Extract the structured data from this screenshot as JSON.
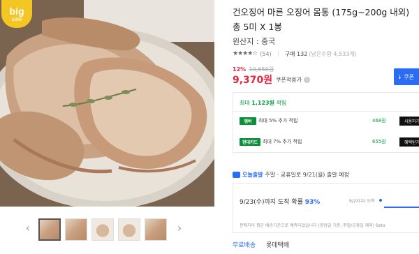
{
  "badge": {
    "line1": "big",
    "line2": "sale"
  },
  "product": {
    "title": "건오징어 마른 오징어 몸통 (175g~200g 내외) 총 5미 X 1봉",
    "origin": "원산지 : 중국",
    "rating": {
      "stars": "★★★★☆",
      "count": "(54)"
    },
    "purchase": {
      "label": "구매 132",
      "stock": "(남은수량 4,533개)"
    }
  },
  "price": {
    "discount_pct": "12%",
    "original": "10,650원",
    "final": "9,370원",
    "coupon_label": "쿠폰적용가",
    "coupon_button": "↓ 쿠폰"
  },
  "points": {
    "header_prefix": "최대 ",
    "header_amount": "1,123원",
    "header_suffix": " 적립",
    "rows": [
      {
        "card": "멤버",
        "desc": "최대 5% 추가 적립",
        "amount": "468원",
        "button": "사용하기"
      },
      {
        "card": "현대카드",
        "desc": "최대 7% 추가 적립",
        "amount": "655원",
        "button": "혜택받기"
      }
    ]
  },
  "delivery": {
    "today_label": "오늘출발",
    "desc": "주말 · 공휴일로 9/21(월) 출발 예정",
    "arrive_text": "9/23(수)까지 도착 확률 ",
    "arrive_pct": "93%",
    "track_label1": "9/23(수) 도착",
    "track_label2": "",
    "note": "판매자의 평균 배송기간으로 예측되었습니다 (영업일 기준, 주말/공휴일 제외) Beta"
  },
  "shipping": {
    "free_label": "무료배송",
    "carrier": "롯데택배"
  },
  "colors": {
    "accent": "#2a6df4",
    "sale": "#e2263e",
    "points": "#0c9b3f",
    "badge": "#f3c623"
  },
  "thumbnails": [
    "squid-thumb-1",
    "squid-thumb-2",
    "squid-thumb-3",
    "squid-thumb-4",
    "squid-thumb-5"
  ]
}
